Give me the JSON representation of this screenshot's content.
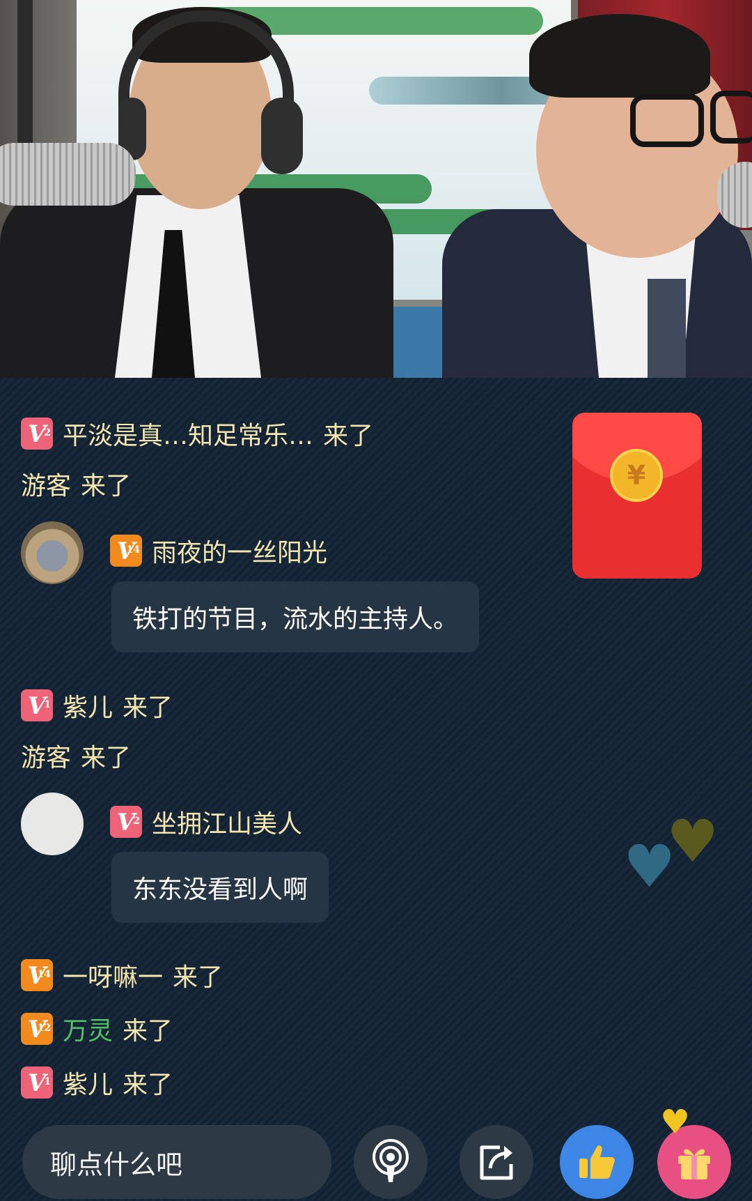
{
  "chat": {
    "messages": [
      {
        "level": "2",
        "user": "平淡是真…知足常乐…",
        "action": "来了"
      },
      {
        "user": "游客",
        "action": "来了"
      },
      {
        "level": "14",
        "user": "雨夜的一丝阳光",
        "text": "铁打的节目，流水的主持人。"
      },
      {
        "level": "1",
        "user": "紫儿",
        "action": "来了"
      },
      {
        "user": "游客",
        "action": "来了"
      },
      {
        "level": "2",
        "user": "坐拥江山美人",
        "text": "东东没看到人啊"
      },
      {
        "level": "14",
        "user": "一呀嘛一",
        "action": "来了"
      },
      {
        "level": "12",
        "user": "万灵",
        "action": "来了"
      },
      {
        "level": "1",
        "user": "紫儿",
        "action": "来了"
      }
    ]
  },
  "red_packet": {
    "symbol": "¥"
  },
  "input": {
    "placeholder": "聊点什么吧"
  },
  "icons": [
    "podcast-icon",
    "share-icon",
    "thumbs-up-icon",
    "gift-icon"
  ],
  "colors": {
    "badge_pink": "#ef6378",
    "badge_orange": "#f38a1e",
    "chat_name": "#f3e6b0",
    "green_name": "#53c267",
    "like_blue": "#3e86e6",
    "gift_pink": "#e84f83"
  }
}
